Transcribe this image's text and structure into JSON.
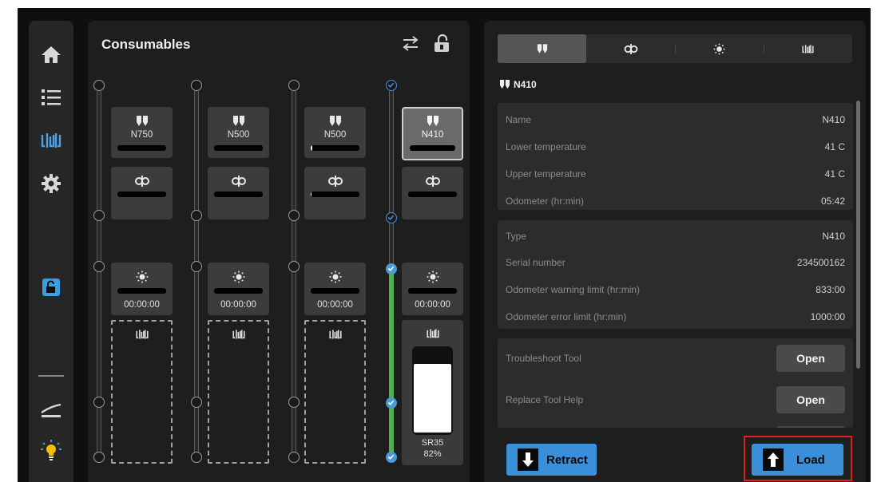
{
  "sidebar": {
    "items": [
      {
        "icon": "home-icon"
      },
      {
        "icon": "list-icon"
      },
      {
        "icon": "consumables-icon",
        "active": true
      },
      {
        "icon": "gear-icon"
      },
      {
        "icon": "unlock-icon"
      },
      {
        "icon": "flatten-icon"
      },
      {
        "icon": "lightbulb-icon"
      }
    ]
  },
  "consumables": {
    "title": "Consumables",
    "columns": [
      {
        "tool": {
          "label": "N750",
          "fill": 0
        },
        "fan_fill": 0,
        "light": {
          "time": "00:00:00",
          "fill": 0
        }
      },
      {
        "tool": {
          "label": "N500",
          "fill": 0
        },
        "fan_fill": 0,
        "light": {
          "time": "00:00:00",
          "fill": 0
        }
      },
      {
        "tool": {
          "label": "N500",
          "fill": 0.04
        },
        "fan_fill": 0.01,
        "light": {
          "time": "00:00:00",
          "fill": 0
        }
      },
      {
        "tool": {
          "label": "N410",
          "fill": 0,
          "selected": true
        },
        "fan_fill": 0,
        "light": {
          "time": "00:00:00",
          "fill": 0
        },
        "resin": {
          "label": "SR35",
          "percent": "82%",
          "level": 0.82
        }
      }
    ]
  },
  "detail": {
    "tabs": [
      {
        "icon": "tool-icon",
        "active": true
      },
      {
        "icon": "fan-icon"
      },
      {
        "icon": "light-icon"
      },
      {
        "icon": "consumables-icon"
      }
    ],
    "section_title": "N410",
    "info_card_1": [
      {
        "key": "Name",
        "value": "N410"
      },
      {
        "key": "Lower temperature",
        "value": "41 C"
      },
      {
        "key": "Upper temperature",
        "value": "41 C"
      },
      {
        "key": "Odometer (hr:min)",
        "value": "05:42"
      }
    ],
    "info_card_2": [
      {
        "key": "Type",
        "value": "N410"
      },
      {
        "key": "Serial number",
        "value": "234500162"
      },
      {
        "key": "Odometer warning limit (hr:min)",
        "value": "833:00"
      },
      {
        "key": "Odometer error limit (hr:min)",
        "value": "1000:00"
      }
    ],
    "actions_card": [
      {
        "label": "Troubleshoot Tool",
        "button": "Open"
      },
      {
        "label": "Replace Tool Help",
        "button": "Open"
      }
    ],
    "retract_label": "Retract",
    "load_label": "Load"
  },
  "colors": {
    "accent": "#3a8fd8",
    "check": "#4a9ad8",
    "resin_track": "#4caf50",
    "highlight": "#e0201e"
  }
}
